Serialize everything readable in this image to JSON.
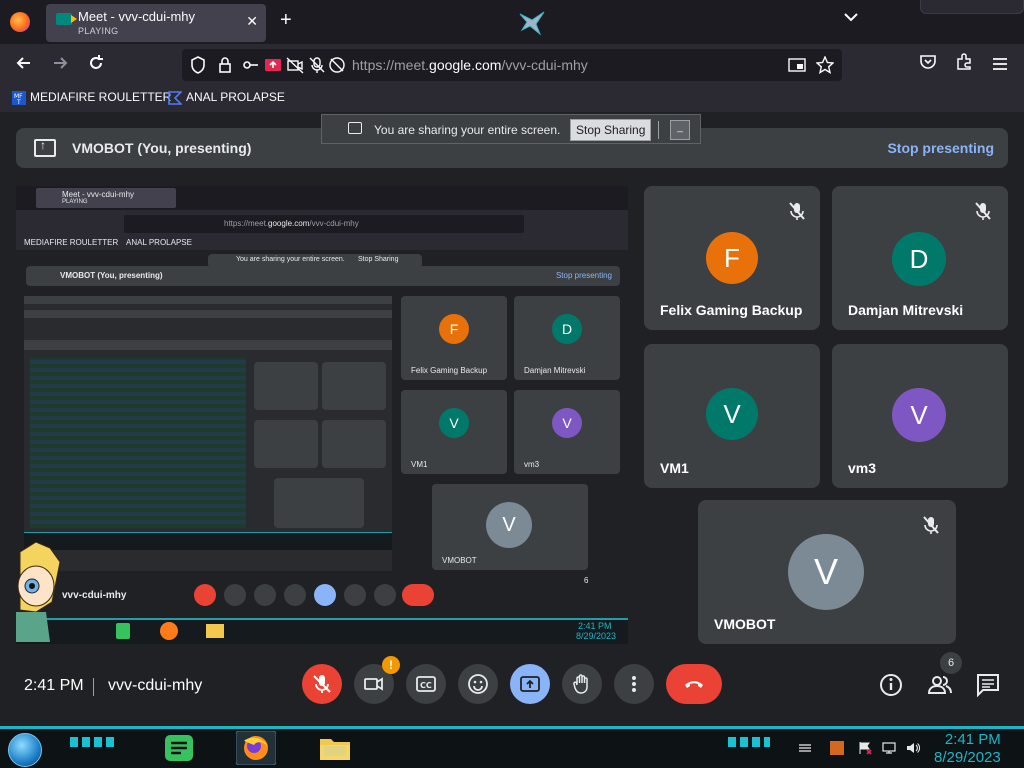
{
  "browser": {
    "tab": {
      "title": "Meet - vvv-cdui-mhy",
      "subtitle": "PLAYING",
      "close": "✕"
    },
    "new_tab": "+",
    "url_host": "https://meet.",
    "url_domain": "google.com",
    "url_path": "/vvv-cdui-mhy",
    "bookmarks": [
      {
        "label": "MEDIAFIRE ROULETTER",
        "icon": "mediafire-icon"
      },
      {
        "label": "ANAL PROLAPSE",
        "icon": "bookmark-icon"
      }
    ]
  },
  "share_banner": {
    "text": "You are sharing your entire screen.",
    "stop_button": "Stop Sharing",
    "hide_button": "_"
  },
  "presenting_bar": {
    "label": "VMOBOT (You, presenting)",
    "stop": "Stop presenting"
  },
  "participants": [
    {
      "name": "Felix Gaming Backup",
      "initial": "F",
      "color": "#e8710a",
      "muted": true
    },
    {
      "name": "Damjan Mitrevski",
      "initial": "D",
      "color": "#00796b",
      "muted": true
    },
    {
      "name": "VM1",
      "initial": "V",
      "color": "#00796b",
      "muted": false
    },
    {
      "name": "vm3",
      "initial": "V",
      "color": "#7e57c2",
      "muted": false
    },
    {
      "name": "VMOBOT",
      "initial": "V",
      "color": "#7b8a95",
      "muted": true
    }
  ],
  "nested_screen": {
    "tab_title": "Meet - vvv-cdui-mhy",
    "tab_sub": "PLAYING",
    "url_host": "https://meet.",
    "url_domain": "google.com",
    "url_path": "/vvv-cdui-mhy",
    "bm1": "MEDIAFIRE ROULETTER",
    "bm2": "ANAL PROLAPSE",
    "banner": "You are sharing your entire screen.",
    "stop_sharing": "Stop Sharing",
    "presenting": "VMOBOT (You, presenting)",
    "stop_presenting": "Stop presenting",
    "tiles": [
      {
        "name": "Felix Gaming Backup",
        "initial": "F"
      },
      {
        "name": "Damjan Mitrevski",
        "initial": "D"
      },
      {
        "name": "VM1",
        "initial": "V"
      },
      {
        "name": "vm3",
        "initial": "V"
      },
      {
        "name": "VMOBOT",
        "initial": "V"
      }
    ],
    "meeting_code": "vvv-cdui-mhy",
    "people_count": "6",
    "clock_time": "2:41 PM",
    "clock_date": "8/29/2023"
  },
  "controls": {
    "time": "2:41 PM",
    "meeting_code": "vvv-cdui-mhy",
    "camera_warning": "!",
    "people_count": "6"
  },
  "taskbar": {
    "time": "2:41 PM",
    "date": "8/29/2023",
    "accent": "#16b8c8"
  }
}
